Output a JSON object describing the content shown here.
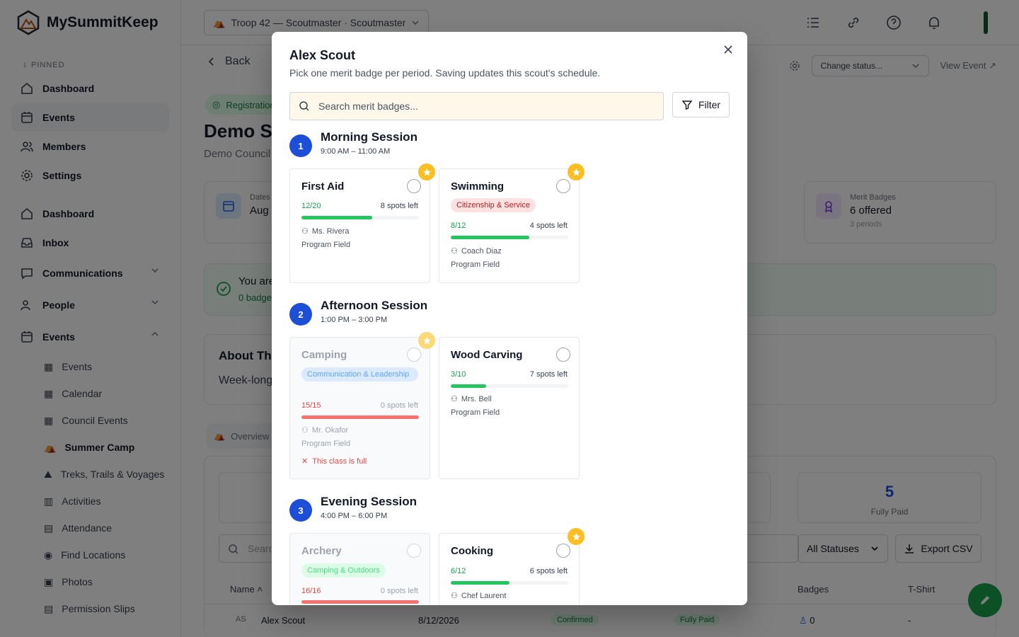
{
  "app": {
    "name": "MySummitKeep"
  },
  "topbar": {
    "troop_selector": "Troop 42 — Scoutmaster · Scoutmaster"
  },
  "sidebar": {
    "pinned_label": "PINNED",
    "pinned": [
      {
        "label": "Dashboard",
        "icon": "home-icon"
      },
      {
        "label": "Events",
        "icon": "calendar-icon"
      },
      {
        "label": "Members",
        "icon": "users-icon"
      },
      {
        "label": "Settings",
        "icon": "gear-icon"
      }
    ],
    "nav": [
      {
        "label": "Dashboard",
        "icon": "home-icon"
      },
      {
        "label": "Inbox",
        "icon": "inbox-icon"
      },
      {
        "label": "Communications",
        "icon": "message-icon"
      },
      {
        "label": "People",
        "icon": "users-icon"
      },
      {
        "label": "Events",
        "icon": "calendar-icon"
      }
    ],
    "events_sub": [
      {
        "label": "Events"
      },
      {
        "label": "Calendar"
      },
      {
        "label": "Council Events"
      },
      {
        "label": "Summer Camp"
      },
      {
        "label": "Treks, Trails & Voyages"
      },
      {
        "label": "Activities"
      },
      {
        "label": "Attendance"
      },
      {
        "label": "Find Locations"
      },
      {
        "label": "Photos"
      },
      {
        "label": "Permission Slips"
      }
    ]
  },
  "page": {
    "back_label": "Back",
    "status_placeholder": "Change status...",
    "view_event": "View Event",
    "registration_badge": "Registration",
    "event_title": "Demo S",
    "event_subtitle": "Demo Council",
    "dates_label": "Dates",
    "dates_value": "Aug 2",
    "merit_label": "Merit Badges",
    "merit_value": "6 offered",
    "merit_note": "3 periods",
    "notice_title": "You are",
    "notice_sub": "0 badge",
    "about_title": "About Th",
    "about_text": "Week-long",
    "overview_tab": "Overview",
    "fully_paid_count": "5",
    "fully_paid_label": "Fully Paid",
    "roster_search_placeholder": "Search",
    "all_statuses": "All Statuses",
    "export_csv": "Export CSV",
    "columns": {
      "name": "Name",
      "badges": "Badges",
      "tshirt": "T-Shirt"
    },
    "row": {
      "initials": "AS",
      "name": "Alex Scout",
      "date": "8/12/2026",
      "status": "Confirmed",
      "payment": "Fully Paid",
      "badges": "0",
      "tshirt": "-"
    }
  },
  "modal": {
    "title": "Alex Scout",
    "subtitle": "Pick one merit badge per period. Saving updates this scout's schedule.",
    "search_placeholder": "Search merit badges...",
    "filter_label": "Filter",
    "sessions": [
      {
        "number": "1",
        "name": "Morning Session",
        "time": "9:00 AM – 11:00 AM",
        "badges": [
          {
            "name": "First Aid",
            "count": "12/20",
            "fill": 0.6,
            "spots": "8 spots left",
            "instructor": "Ms. Rivera",
            "location": "Program Field",
            "featured": true
          },
          {
            "name": "Swimming",
            "tag": "Citizenship & Service",
            "count": "8/12",
            "fill": 0.67,
            "spots": "4 spots left",
            "instructor": "Coach Diaz",
            "location": "Program Field",
            "featured": true
          }
        ]
      },
      {
        "number": "2",
        "name": "Afternoon Session",
        "time": "1:00 PM – 3:00 PM",
        "badges": [
          {
            "name": "Camping",
            "tag": "Communication & Leadership",
            "count": "15/15",
            "fill": 1.0,
            "spots": "0 spots left",
            "instructor": "Mr. Okafor",
            "location": "Program Field",
            "warning": "This class is full",
            "featured": true
          },
          {
            "name": "Wood Carving",
            "count": "3/10",
            "fill": 0.3,
            "spots": "7 spots left",
            "instructor": "Mrs. Bell",
            "location": "Program Field"
          }
        ]
      },
      {
        "number": "3",
        "name": "Evening Session",
        "time": "4:00 PM – 6:00 PM",
        "badges": [
          {
            "name": "Archery",
            "tag": "Camping & Outdoors",
            "count": "16/16",
            "fill": 1.0,
            "spots": "0 spots left"
          },
          {
            "name": "Cooking",
            "count": "6/12",
            "fill": 0.5,
            "spots": "6 spots left",
            "instructor": "Chef Laurent",
            "featured": true
          }
        ]
      }
    ]
  }
}
